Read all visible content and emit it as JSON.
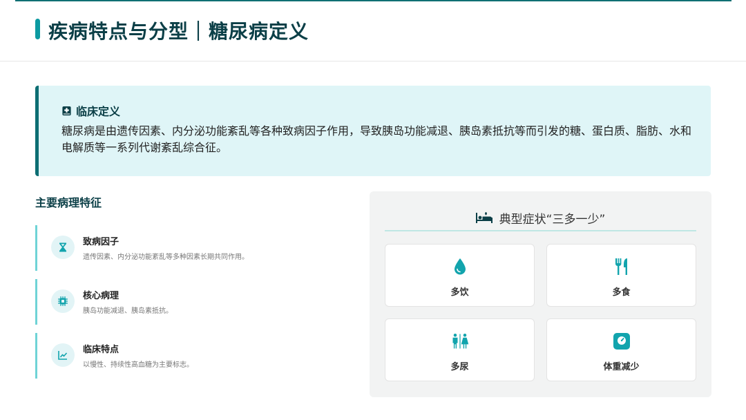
{
  "header": {
    "title": "疾病特点与分型｜糖尿病定义"
  },
  "definition": {
    "title": "临床定义",
    "text": "糖尿病是由遗传因素、内分泌功能紊乱等各种致病因子作用，导致胰岛功能减退、胰岛素抵抗等而引发的糖、蛋白质、脂肪、水和电解质等一系列代谢紊乱综合征。"
  },
  "features": {
    "title": "主要病理特征",
    "items": [
      {
        "title": "致病因子",
        "desc": "遗传因素、内分泌功能紊乱等多种因素长期共同作用。",
        "icon": "hourglass-icon"
      },
      {
        "title": "核心病理",
        "desc": "胰岛功能减退、胰岛素抵抗。",
        "icon": "chip-icon"
      },
      {
        "title": "临床特点",
        "desc": "以慢性、持续性高血糖为主要标志。",
        "icon": "trend-chart-icon"
      }
    ]
  },
  "symptoms": {
    "title": "典型症状“三多一少”",
    "icon": "bed-icon",
    "items": [
      {
        "label": "多饮",
        "icon": "water-drop-icon"
      },
      {
        "label": "多食",
        "icon": "utensils-icon"
      },
      {
        "label": "多尿",
        "icon": "restroom-icon"
      },
      {
        "label": "体重减少",
        "icon": "weight-scale-icon"
      }
    ]
  },
  "colors": {
    "primary": "#0b3f47",
    "accent": "#0c9aa1",
    "icon_teal": "#12a4ad",
    "definition_bg": "#dff5f7"
  }
}
